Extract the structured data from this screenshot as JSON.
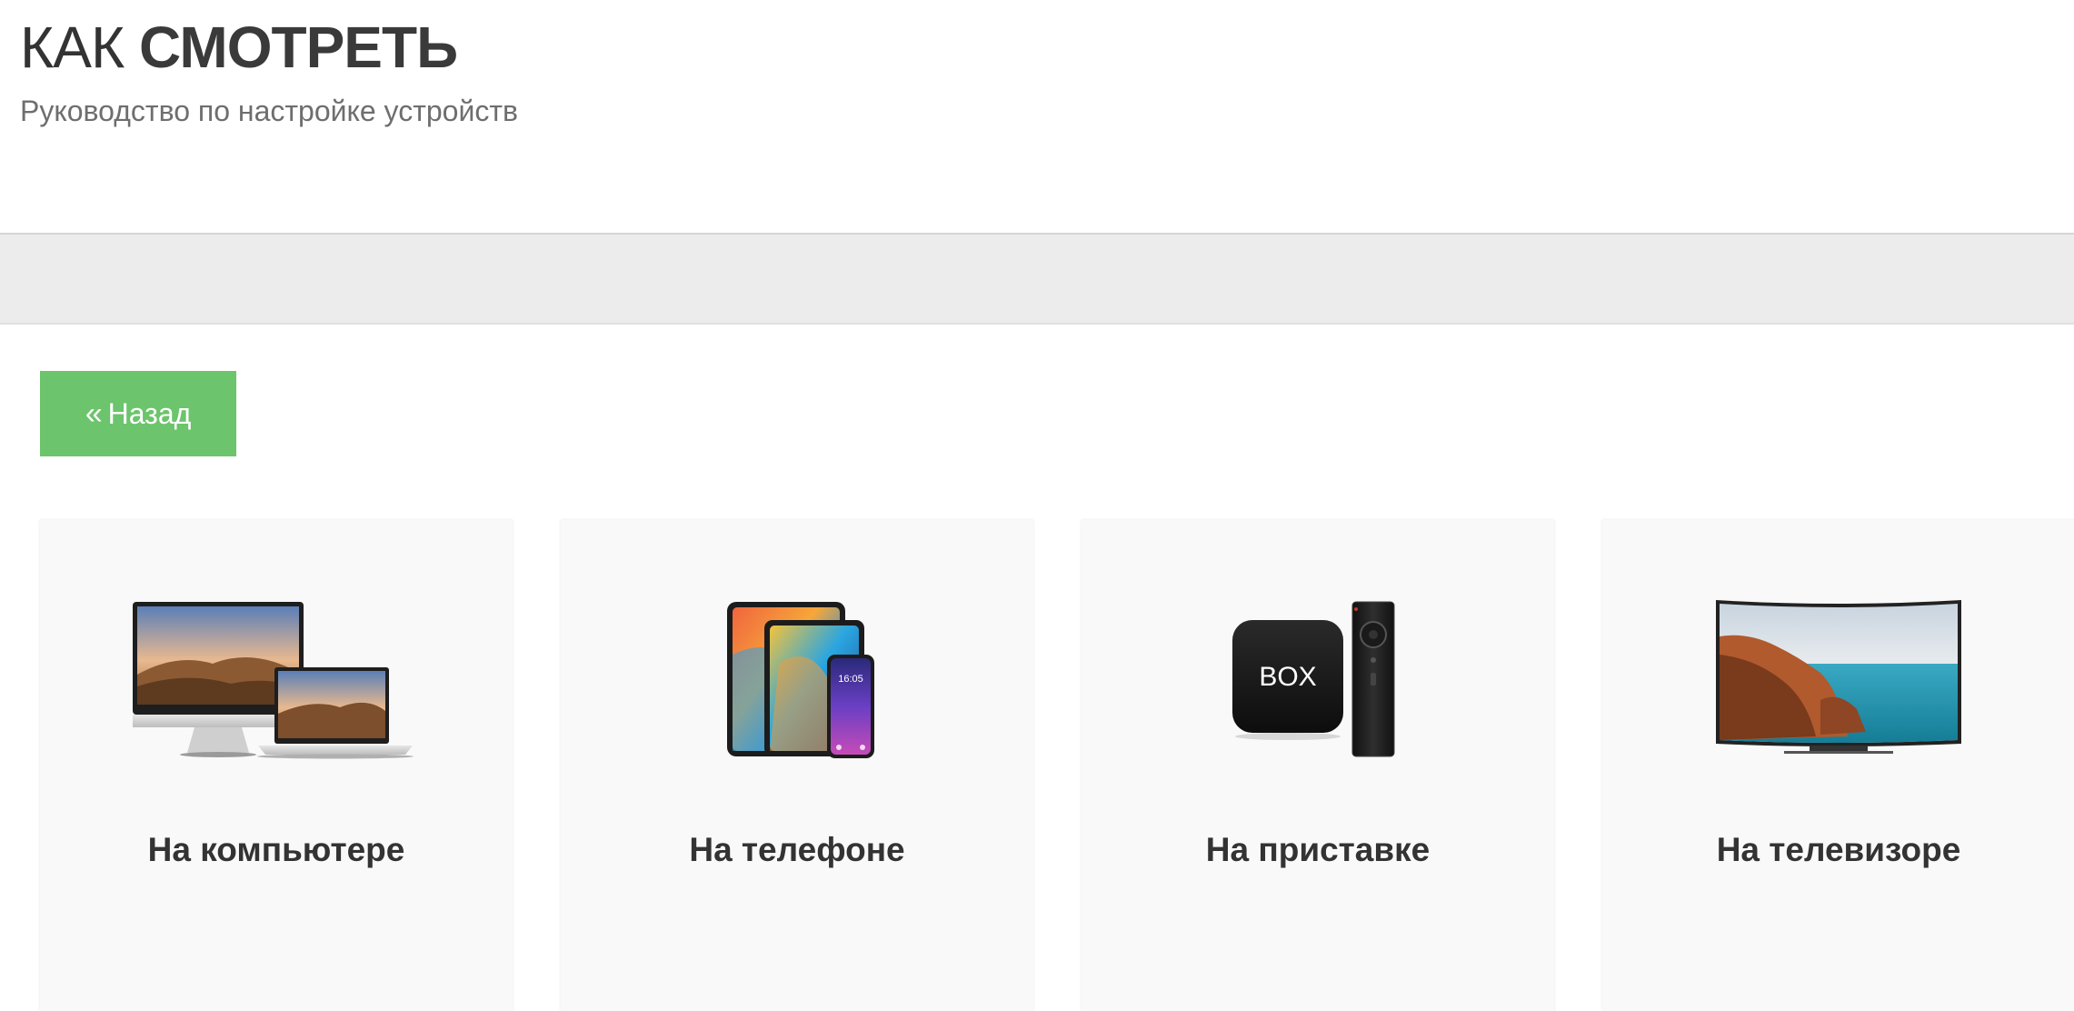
{
  "header": {
    "title_light": "КАК",
    "title_bold": "СМОТРЕТЬ",
    "subtitle": "Руководство по настройке устройств"
  },
  "back_button": {
    "icon": "double-chevron-left-icon",
    "label": "Назад"
  },
  "cards": [
    {
      "label": "На компьютере",
      "image": "computer-laptop-image"
    },
    {
      "label": "На телефоне",
      "image": "tablet-phone-image"
    },
    {
      "label": "На приставке",
      "image": "tv-box-remote-image",
      "box_text": "BOX",
      "phone_time": ""
    },
    {
      "label": "На телевизоре",
      "image": "curved-tv-image"
    }
  ],
  "phone_time": "16:05",
  "colors": {
    "button_green": "#6cc46c",
    "band_grey": "#ececec",
    "card_bg": "#f9f9f9",
    "text_dark": "#333333",
    "subtitle_grey": "#6e6e6e"
  }
}
